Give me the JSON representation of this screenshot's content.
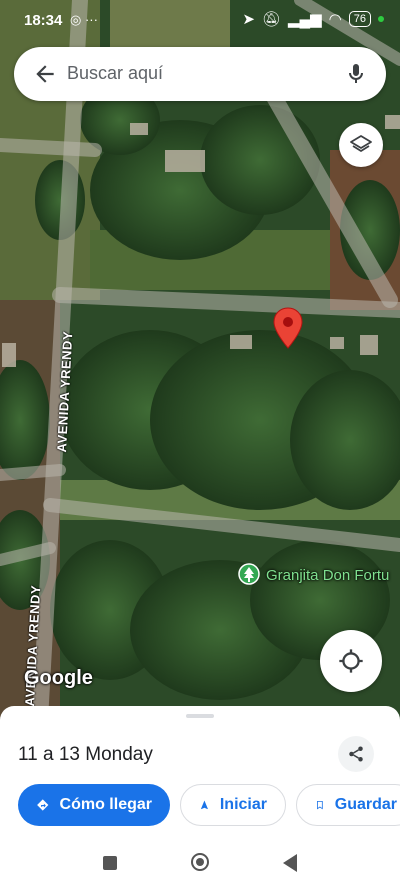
{
  "status_bar": {
    "time": "18:34",
    "battery": "76",
    "icons": [
      "instagram-icon",
      "more-icon",
      "location-arrow-icon",
      "mute-icon",
      "signal-icon",
      "wifi-icon",
      "battery-icon"
    ]
  },
  "search": {
    "placeholder": "Buscar aquí"
  },
  "map": {
    "streets": [
      "AVENIDA YRENDY",
      "AVENIDA YRENDY"
    ],
    "poi_label": "Granjita Don Fortu",
    "logo": "Google"
  },
  "place": {
    "title": "11 a 13 Monday"
  },
  "actions": {
    "directions": "Cómo llegar",
    "start": "Iniciar",
    "save": "Guardar"
  },
  "colors": {
    "accent": "#1a73e8",
    "pin": "#ea4335",
    "poi": "#34a853"
  }
}
